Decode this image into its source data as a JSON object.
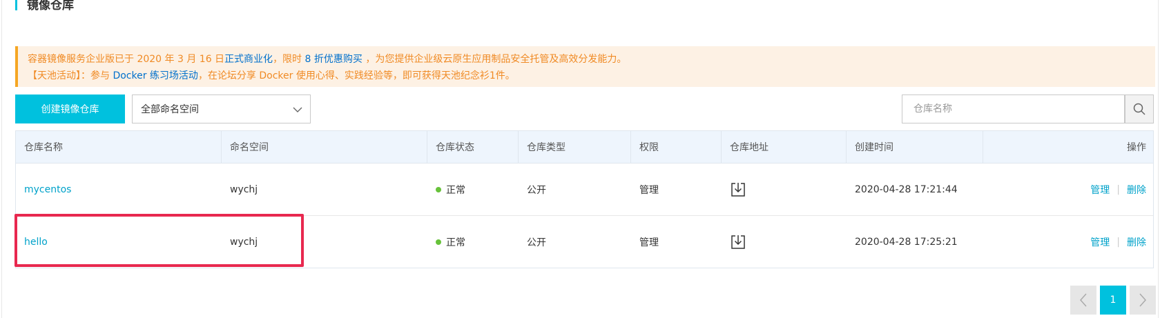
{
  "header": {
    "title": "镜像仓库"
  },
  "notice": {
    "line1": {
      "p1": "容器镜像服务企业版已于 2020 年 3 月 16 日",
      "link1": "正式商业化",
      "p2": "，限时 ",
      "link2": "8 折优惠购买",
      "p3": " ，为您提供企业级云原生应用制品安全托管及高效分发能力。"
    },
    "line2": {
      "p1": "【天池活动】：参与 ",
      "link1": "Docker 练习场活动",
      "p2": "，在论坛分享 Docker 使用心得、实践经验等，即可获得天池纪念衫1件。"
    }
  },
  "toolbar": {
    "create_label": "创建镜像仓库",
    "namespace_selected": "全部命名空间",
    "search_placeholder": "仓库名称"
  },
  "table": {
    "headers": [
      "仓库名称",
      "命名空间",
      "仓库状态",
      "仓库类型",
      "权限",
      "仓库地址",
      "创建时间",
      "操作"
    ],
    "rows": [
      {
        "name": "mycentos",
        "namespace": "wychj",
        "status": "正常",
        "type": "公开",
        "permission": "管理",
        "address_icon": "download-icon",
        "created": "2020-04-28 17:21:44",
        "op_manage": "管理",
        "op_sep": "|",
        "op_delete": "删除"
      },
      {
        "name": "hello",
        "namespace": "wychj",
        "status": "正常",
        "type": "公开",
        "permission": "管理",
        "address_icon": "download-icon",
        "created": "2020-04-28 17:25:21",
        "op_manage": "管理",
        "op_sep": "|",
        "op_delete": "删除"
      }
    ]
  },
  "pagination": {
    "current": "1"
  },
  "colors": {
    "accent": "#00c1de",
    "link": "#00a2ca",
    "notice_text": "#f08a24",
    "notice_bg": "#fdf1e4",
    "status_ok": "#67c23a",
    "highlight": "#e8284f"
  }
}
